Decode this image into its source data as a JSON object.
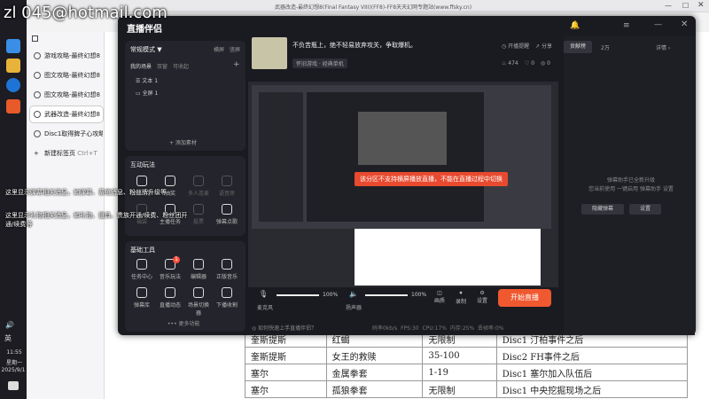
{
  "watermark": "zl  045@hotmail.com",
  "browser": {
    "title": "武器改造-最终幻想8(Final Fantasy VIII)(FF8)-FF8天天幻网专题站(www.ffsky.cn)",
    "new_tab_label": "新建标签页",
    "new_tab_shortcut": "Ctrl+T",
    "tabs": [
      "游戏攻略-最终幻想8",
      "图文攻略-最终幻想8",
      "图文攻略-最终幻想8",
      "武器改造-最终幻想8",
      "Disc1取得脾子心攻略"
    ]
  },
  "page_table": {
    "rows": [
      [
        "奎斯提斯",
        "红蝎",
        "无限制",
        "Disc1 汀柏事件之后"
      ],
      [
        "奎斯提斯",
        "女王的救赎",
        "35-100",
        "Disc2 FH事件之后"
      ],
      [
        "塞尔",
        "金属拳套",
        "1-19",
        "Disc1 塞尔加入队伍后"
      ],
      [
        "塞尔",
        "孤狼拳套",
        "无限制",
        "Disc1 中央挖掘现场之后"
      ]
    ]
  },
  "app": {
    "logo": "直播伴侣",
    "mode_label": "常规模式 ▼",
    "mode_edit": "横屏",
    "mode_vertical": "竖屏",
    "scenes_label": "我的场景",
    "scenes_tabs": [
      "双窗",
      "可收起"
    ],
    "sources": [
      "文本 1",
      "全屏 1"
    ],
    "add_source": "+ 添加素材",
    "interact_title": "互动玩法",
    "interact_tiles": [
      "弹幕助手",
      "抽奖",
      "多人连麦",
      "语音房",
      "福袋",
      "主播任务",
      "投票",
      "弹幕点歌"
    ],
    "tools_title": "基础工具",
    "tool_tiles": [
      "任务中心",
      "音乐玩法",
      "编辑器",
      "正版音乐",
      "弹幕库",
      "直播动态",
      "场景切换器",
      "下播收割"
    ],
    "tool_badge": "1",
    "more_tools": "••• 更多功能",
    "stream_title": "不负苦瓶上，绝不轻易放弃攻关，争取爆机。",
    "category": "怀旧游戏 · 经典单机",
    "host_follow": "开播提醒",
    "host_share": "分享",
    "stats": [
      "474",
      "0",
      "0"
    ],
    "preview_toast": "该分区不支持横屏播放直播，不能在直播过程中切换",
    "mic_label": "麦克风",
    "mic_pct": "100%",
    "speaker_label": "扬声器",
    "speaker_pct": "100%",
    "bottom_icons": [
      "画质",
      "录制",
      "设置"
    ],
    "start_button": "开始直播",
    "status_bar": "◎ 如何快速上手直播伴侣？",
    "status_items": [
      "码率0kb/s",
      "FPS:30",
      "CPU:17%",
      "内存:25%",
      "丢帧率:0%"
    ],
    "right_tabs": [
      "贡献榜",
      "2万"
    ],
    "right_detail": "详情 ›",
    "danmu_msg_1": "弹幕助手已全新升级",
    "danmu_msg_2": "您当前使用 一键启用 弹幕助手 设置",
    "hide_button": "隐藏弹幕",
    "settings_button": "设置"
  },
  "overlay_notes": [
    "这里显示弹幕相关消息，如弹幕、系统消息、粉丝牌升级等",
    "这里显示礼物相关消息，如礼物、道具、贵族开通/续费、粉丝团开通/续费等"
  ],
  "taskbar": {
    "time": "11:55",
    "weekday": "星期一",
    "date": "2025/9/1",
    "lang": "英"
  },
  "colors": {
    "accent": "#f0582f",
    "panel": "#24252c",
    "bg": "#1a1b21"
  }
}
